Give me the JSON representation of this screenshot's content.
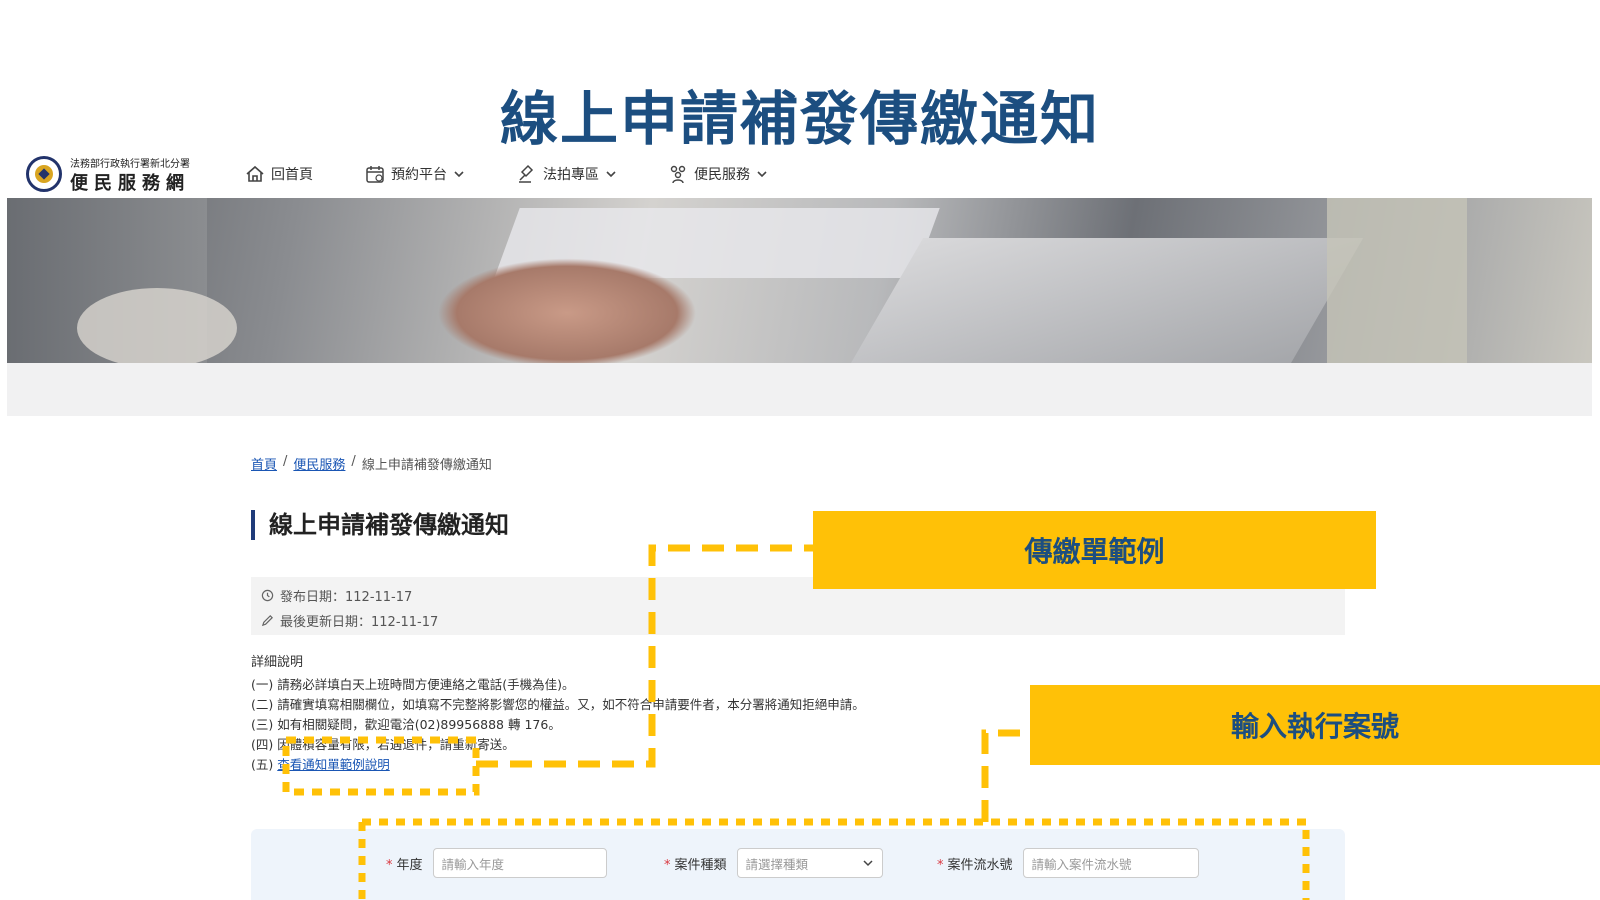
{
  "slide": {
    "title": "線上申請補發傳繳通知"
  },
  "logo": {
    "subtitle": "法務部行政執行署新北分署",
    "name": "便民服務網"
  },
  "nav": {
    "home": "回首頁",
    "booking": "預約平台",
    "auction": "法拍專區",
    "service": "便民服務"
  },
  "breadcrumb": {
    "home": "首頁",
    "service": "便民服務",
    "current": "線上申請補發傳繳通知"
  },
  "page": {
    "heading": "線上申請補發傳繳通知",
    "publish_date": "發布日期：112-11-17",
    "update_date": "最後更新日期：112-11-17",
    "detail_label": "詳細說明",
    "items": [
      "(一) 請務必詳填白天上班時間方便連絡之電話(手機為佳)。",
      "(二) 請確實填寫相關欄位，如填寫不完整將影響您的權益。又，如不符合申請要件者，本分署將通知拒絕申請。",
      "(三) 如有相關疑問，歡迎電洽(02)89956888 轉 176。",
      "(四) 因體積容量有限，若遇退件，請重新寄送。"
    ],
    "item5_prefix": "(五)",
    "item5_link": "查看通知單範例說明"
  },
  "form": {
    "year_label": "年度",
    "year_placeholder": "請輸入年度",
    "type_label": "案件種類",
    "type_placeholder": "請選擇種類",
    "serial_label": "案件流水號",
    "serial_placeholder": "請輸入案件流水號"
  },
  "callouts": {
    "example": "傳繳單範例",
    "case_number": "輸入執行案號"
  },
  "colors": {
    "accent": "#ffc107",
    "title": "#1c4e80",
    "link": "#1a56b4"
  }
}
